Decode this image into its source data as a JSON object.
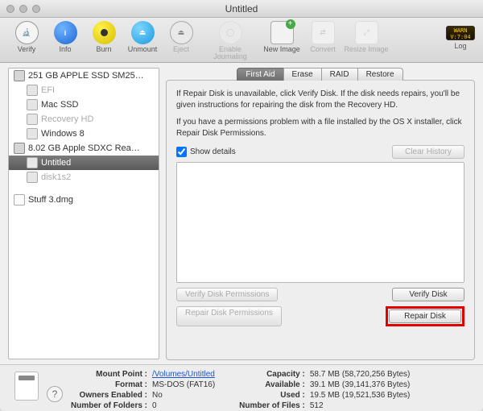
{
  "window": {
    "title": "Untitled"
  },
  "toolbar": {
    "verify": "Verify",
    "info": "Info",
    "burn": "Burn",
    "unmount": "Unmount",
    "eject": "Eject",
    "journal": "Enable Journaling",
    "newimg": "New Image",
    "convert": "Convert",
    "resize": "Resize Image",
    "log": "Log"
  },
  "sidebar": {
    "disk0": "251 GB APPLE SSD SM25…",
    "disk0_children": {
      "efi": "EFI",
      "mac": "Mac SSD",
      "recovery": "Recovery HD",
      "win": "Windows 8"
    },
    "disk1": "8.02 GB Apple SDXC Rea…",
    "disk1_children": {
      "untitled": "Untitled",
      "slice": "disk1s2"
    },
    "dmg": "Stuff 3.dmg"
  },
  "tabs": {
    "firstaid": "First Aid",
    "erase": "Erase",
    "raid": "RAID",
    "restore": "Restore"
  },
  "panel": {
    "help1": "If Repair Disk is unavailable, click Verify Disk. If the disk needs repairs, you'll be given instructions for repairing the disk from the Recovery HD.",
    "help2": "If you have a permissions problem with a file installed by the OS X installer, click Repair Disk Permissions.",
    "show_details": "Show details",
    "clear_history": "Clear History",
    "verify_perm": "Verify Disk Permissions",
    "verify_disk": "Verify Disk",
    "repair_perm": "Repair Disk Permissions",
    "repair_disk": "Repair Disk"
  },
  "footer": {
    "mount_point_k": "Mount Point :",
    "mount_point_v": "/Volumes/Untitled",
    "format_k": "Format :",
    "format_v": "MS-DOS (FAT16)",
    "owners_k": "Owners Enabled :",
    "owners_v": "No",
    "folders_k": "Number of Folders :",
    "folders_v": "0",
    "capacity_k": "Capacity :",
    "capacity_v": "58.7 MB (58,720,256 Bytes)",
    "available_k": "Available :",
    "available_v": "39.1 MB (39,141,376 Bytes)",
    "used_k": "Used :",
    "used_v": "19.5 MB (19,521,536 Bytes)",
    "files_k": "Number of Files :",
    "files_v": "512"
  }
}
